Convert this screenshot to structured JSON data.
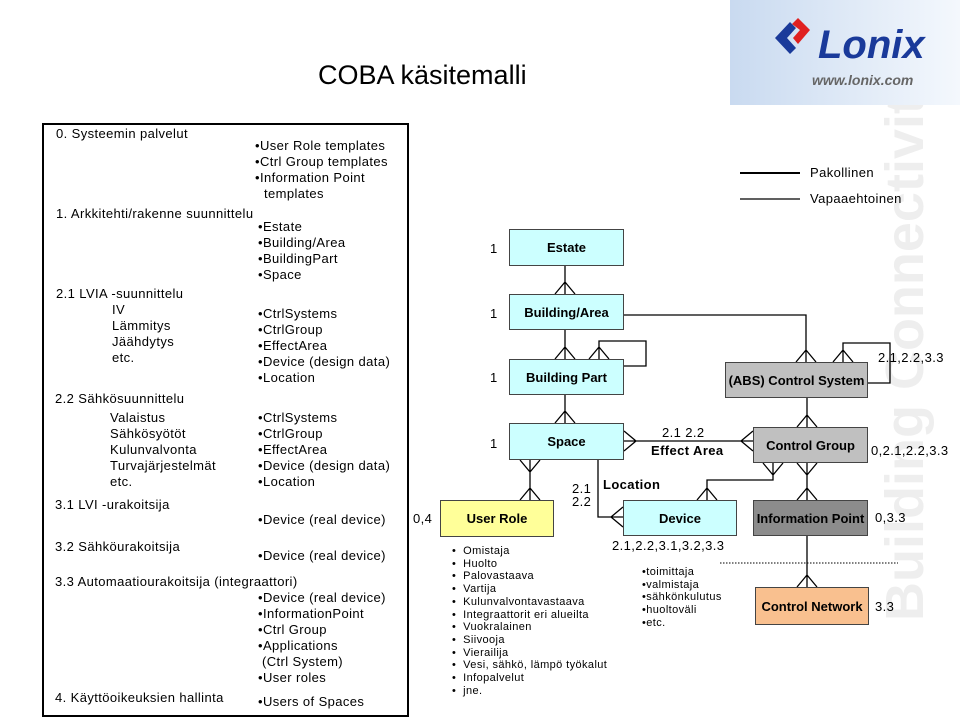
{
  "title": "COBA käsitemalli",
  "logo": {
    "brand": "Lonix",
    "url": "www.lonix.com",
    "colors": {
      "blue": "#1a3a9a",
      "red": "#e02020"
    }
  },
  "watermark": "Building Connectivity",
  "left_panel": {
    "s0": "0. Systeemin palvelut",
    "s0_items": [
      "User Role templates",
      "Ctrl Group templates",
      "Information Point",
      "templates"
    ],
    "s1": "1. Arkkitehti/rakenne suunnittelu",
    "s1_items": [
      "Estate",
      "Building/Area",
      "BuildingPart",
      "Space"
    ],
    "s21": "2.1 LVIA -suunnittelu",
    "s21_sub": [
      "IV",
      "Lämmitys",
      "Jäähdytys",
      "etc."
    ],
    "s21_items": [
      "CtrlSystems",
      "CtrlGroup",
      "EffectArea",
      "Device (design data)",
      "Location"
    ],
    "s22": "2.2 Sähkösuunnittelu",
    "s22_sub": [
      "Valaistus",
      "Sähkösyötöt",
      "Kulunvalvonta",
      "Turvajärjestelmät",
      "etc."
    ],
    "s22_items": [
      "CtrlSystems",
      "CtrlGroup",
      "EffectArea",
      "Device (design data)",
      "Location"
    ],
    "s31": "3.1 LVI -urakoitsija",
    "s31_item": "Device (real device)",
    "s32": "3.2 Sähköurakoitsija",
    "s32_item": "Device (real device)",
    "s33": "3.3 Automaatiourakoitsija (integraattori)",
    "s33_items": [
      "Device (real device)",
      "InformationPoint",
      "Ctrl Group",
      "Applications",
      "(Ctrl System)",
      "User roles"
    ],
    "s4": "4. Käyttöoikeuksien hallinta",
    "s4_item": "Users of Spaces"
  },
  "legend": {
    "mandatory": "Pakollinen",
    "optional": "Vapaaehtoinen"
  },
  "entities": {
    "estate": "Estate",
    "building_area": "Building/Area",
    "building_part": "Building Part",
    "space": "Space",
    "user_role": "User Role",
    "device": "Device",
    "control_system": "(ABS) Control System",
    "control_group": "Control Group",
    "information_point": "Information Point",
    "control_network": "Control Network"
  },
  "labels": {
    "one": "1",
    "user_role_card": "0,4",
    "effect_area_phase": "2.1 2.2",
    "effect_area": "Effect Area",
    "location": "Location",
    "location_phase1": "2.1",
    "location_phase2": "2.2",
    "device_phase": "2.1,2.2,3.1,3.2,3.3",
    "control_system_phase": "2.1,2.2,3.3",
    "control_group_phase": "0,2.1,2.2,3.3",
    "information_point_phase": "0,3.3",
    "control_network_phase": "3.3"
  },
  "user_roles": [
    "Omistaja",
    "Huolto",
    "Palovastaava",
    "Vartija",
    "Kulunvalvontavastaava",
    "Integraattorit eri alueilta",
    "Vuokralainen",
    "Siivooja",
    "Vierailija",
    "Vesi, sähkö, lämpö työkalut",
    "Infopalvelut",
    "jne."
  ],
  "device_attrs": [
    "toimittaja",
    "valmistaja",
    "sähkönkulutus",
    "huoltoväli",
    "etc."
  ]
}
